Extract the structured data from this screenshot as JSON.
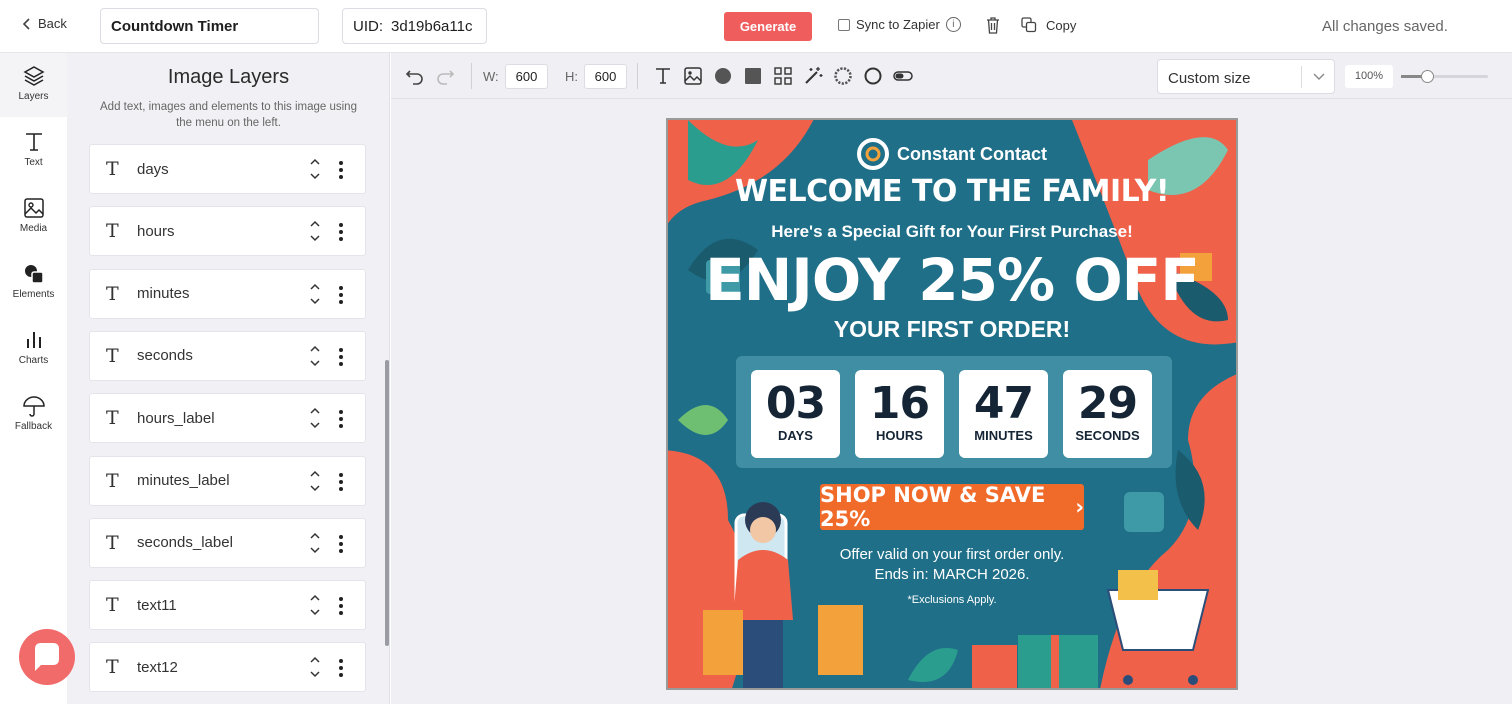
{
  "topbar": {
    "back_label": "Back",
    "title_value": "Countdown Timer",
    "uid_label": "UID:",
    "uid_value": "3d19b6a11c",
    "generate_label": "Generate",
    "sync_label": "Sync to Zapier",
    "copy_label": "Copy",
    "status_text": "All changes saved."
  },
  "rail": {
    "items": [
      {
        "label": "Layers",
        "icon": "layers-icon"
      },
      {
        "label": "Text",
        "icon": "text-icon"
      },
      {
        "label": "Media",
        "icon": "image-icon"
      },
      {
        "label": "Elements",
        "icon": "shapes-icon"
      },
      {
        "label": "Charts",
        "icon": "bar-chart-icon"
      },
      {
        "label": "Fallback",
        "icon": "umbrella-icon"
      }
    ]
  },
  "panel": {
    "title": "Image Layers",
    "subtitle": "Add text, images and elements to this image using the menu on the left.",
    "layers": [
      "days",
      "hours",
      "minutes",
      "seconds",
      "hours_label",
      "minutes_label",
      "seconds_label",
      "text11",
      "text12"
    ]
  },
  "toolbar": {
    "w_label": "W:",
    "w_value": "600",
    "h_label": "H:",
    "h_value": "600",
    "size_select": "Custom size",
    "zoom": "100%",
    "zoom_fraction": 0.25
  },
  "artwork": {
    "brand": "Constant Contact",
    "headline": "WELCOME TO THE FAMILY!",
    "subhead": "Here's a Special Gift for Your First Purchase!",
    "offer": "ENJOY 25% OFF",
    "offer_sub": "YOUR FIRST ORDER!",
    "countdown": [
      {
        "value": "03",
        "label": "DAYS"
      },
      {
        "value": "16",
        "label": "HOURS"
      },
      {
        "value": "47",
        "label": "MINUTES"
      },
      {
        "value": "29",
        "label": "SECONDS"
      }
    ],
    "cta": "SHOP NOW & SAVE 25%",
    "cta_arrow": "›",
    "fine1": "Offer valid on your first order only.",
    "fine2": "Ends in: MARCH 2026.",
    "fine3": "*Exclusions Apply."
  },
  "colors": {
    "accent": "#ef5d5d",
    "art_bg": "#1f6f88",
    "coral": "#f0614a",
    "cta": "#f06a2a"
  }
}
